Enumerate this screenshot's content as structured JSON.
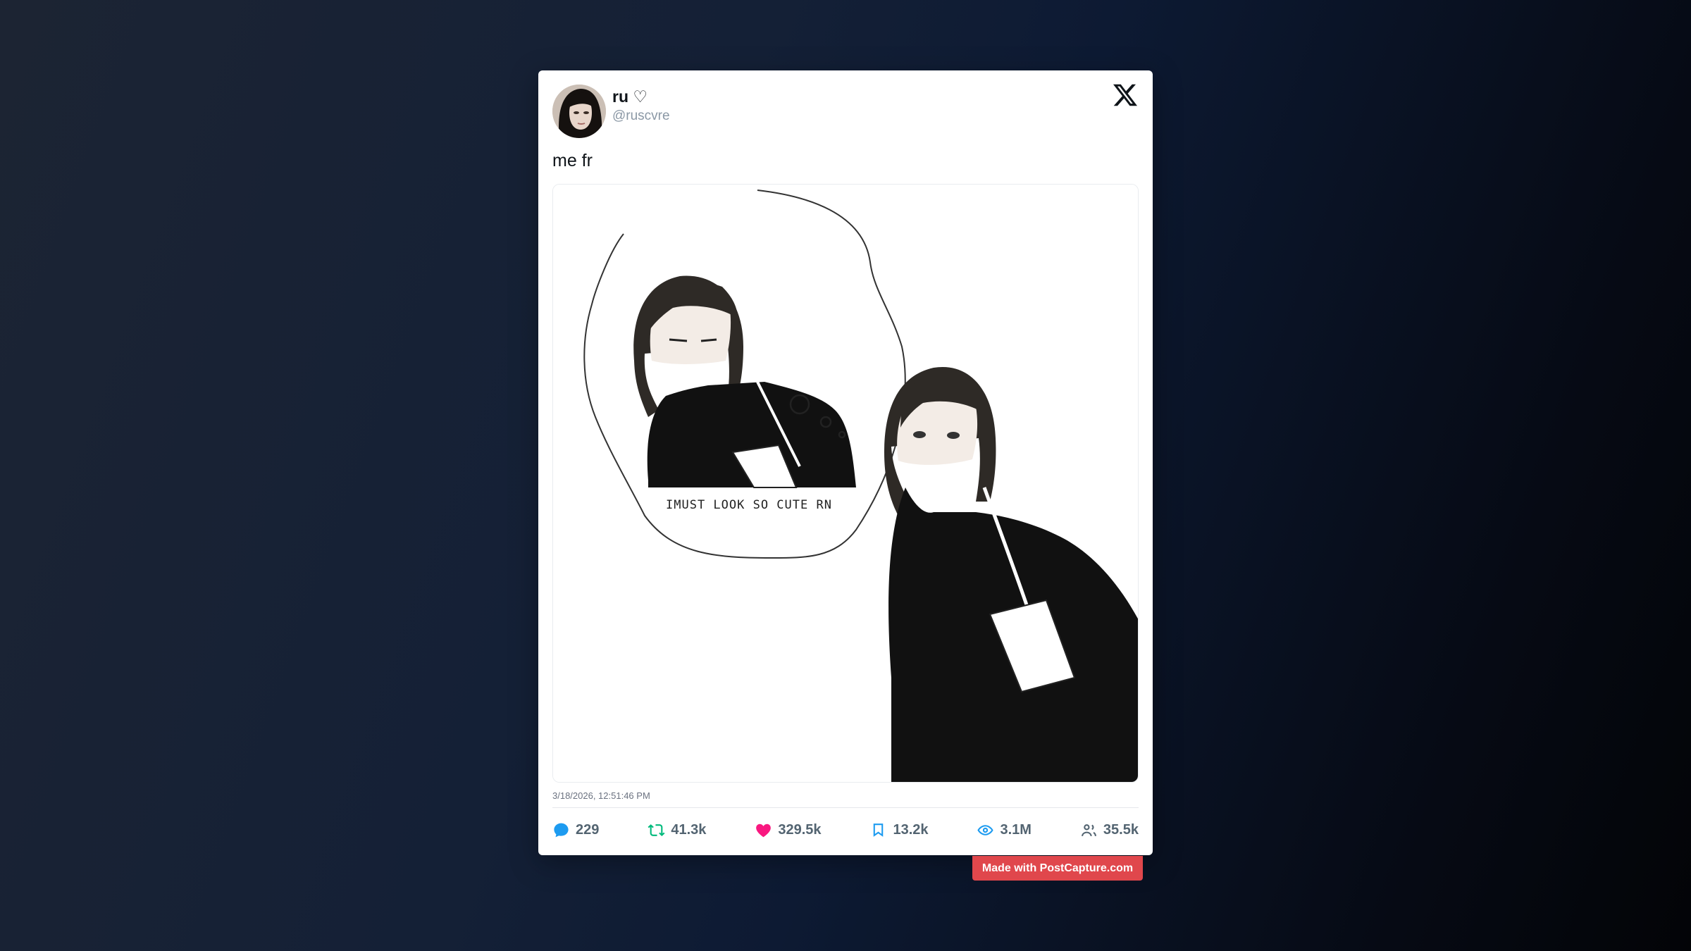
{
  "post": {
    "author": {
      "display_name": "ru ♡",
      "handle": "@ruscvre",
      "avatar_icon": "profile-photo"
    },
    "platform_icon": "x-logo-icon",
    "text": "me fr",
    "media": {
      "caption_in_image": "IMUST LOOK SO CUTE RN"
    },
    "timestamp": "3/18/2026, 12:51:46 PM",
    "stats": {
      "replies": "229",
      "reposts": "41.3k",
      "likes": "329.5k",
      "bookmarks": "13.2k",
      "views": "3.1M",
      "followers": "35.5k"
    }
  },
  "colors": {
    "reply": "#1d9bf0",
    "repost": "#00ba7c",
    "like": "#f91880",
    "bookmark": "#1d9bf0",
    "views": "#1d9bf0",
    "followers": "#536471",
    "watermark_bg": "#e0474c"
  },
  "watermark": {
    "label": "Made with PostCapture.com"
  }
}
